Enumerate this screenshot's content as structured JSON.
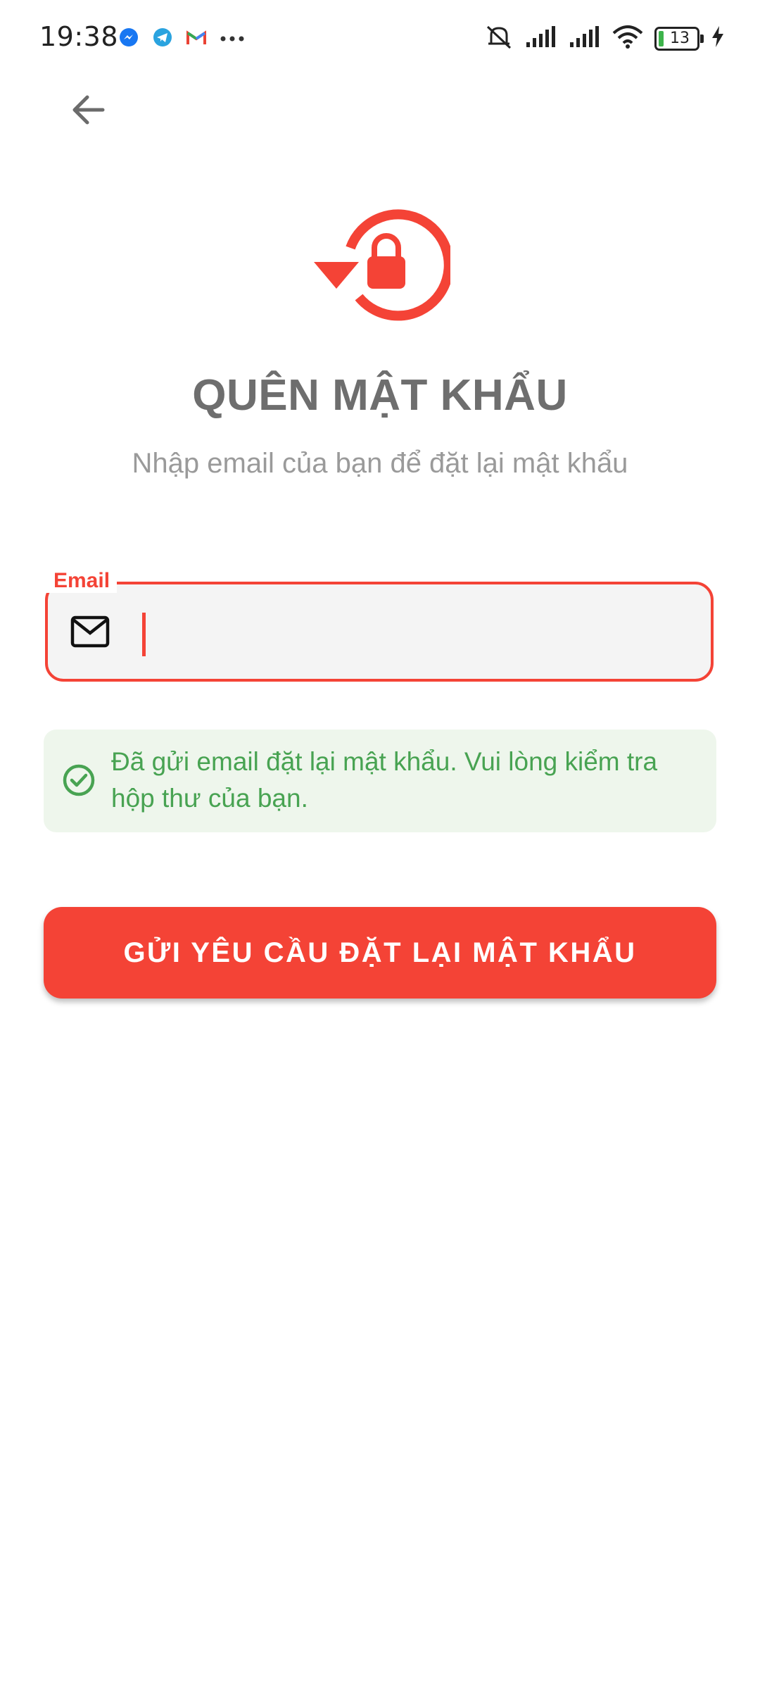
{
  "status_bar": {
    "time": "19:38",
    "battery_level": "13",
    "notification_icons": [
      "messenger-icon",
      "telegram-icon",
      "gmail-icon",
      "more-dots-icon"
    ],
    "system_icons": [
      "mute-icon",
      "signal-icon",
      "signal-icon",
      "wifi-icon",
      "battery-icon",
      "charging-icon"
    ]
  },
  "header": {
    "back_icon": "arrow-left-icon",
    "logo_icon": "lock-reset-icon"
  },
  "main": {
    "title": "QUÊN MẬT KHẨU",
    "subtitle": "Nhập email của bạn để đặt lại mật khẩu",
    "email_field": {
      "label": "Email",
      "value": "",
      "icon": "mail-icon"
    },
    "success_message": "Đã gửi email đặt lại mật khẩu. Vui lòng kiểm tra hộp thư của bạn.",
    "submit_label": "GỬI YÊU CẦU ĐẶT LẠI MẬT KHẨU"
  },
  "colors": {
    "accent": "#f44336",
    "title": "#6e6e6e",
    "subtitle": "#9a9a9a",
    "success_text": "#48a352",
    "success_bg": "#eef6ec",
    "field_bg": "#f4f4f4"
  }
}
